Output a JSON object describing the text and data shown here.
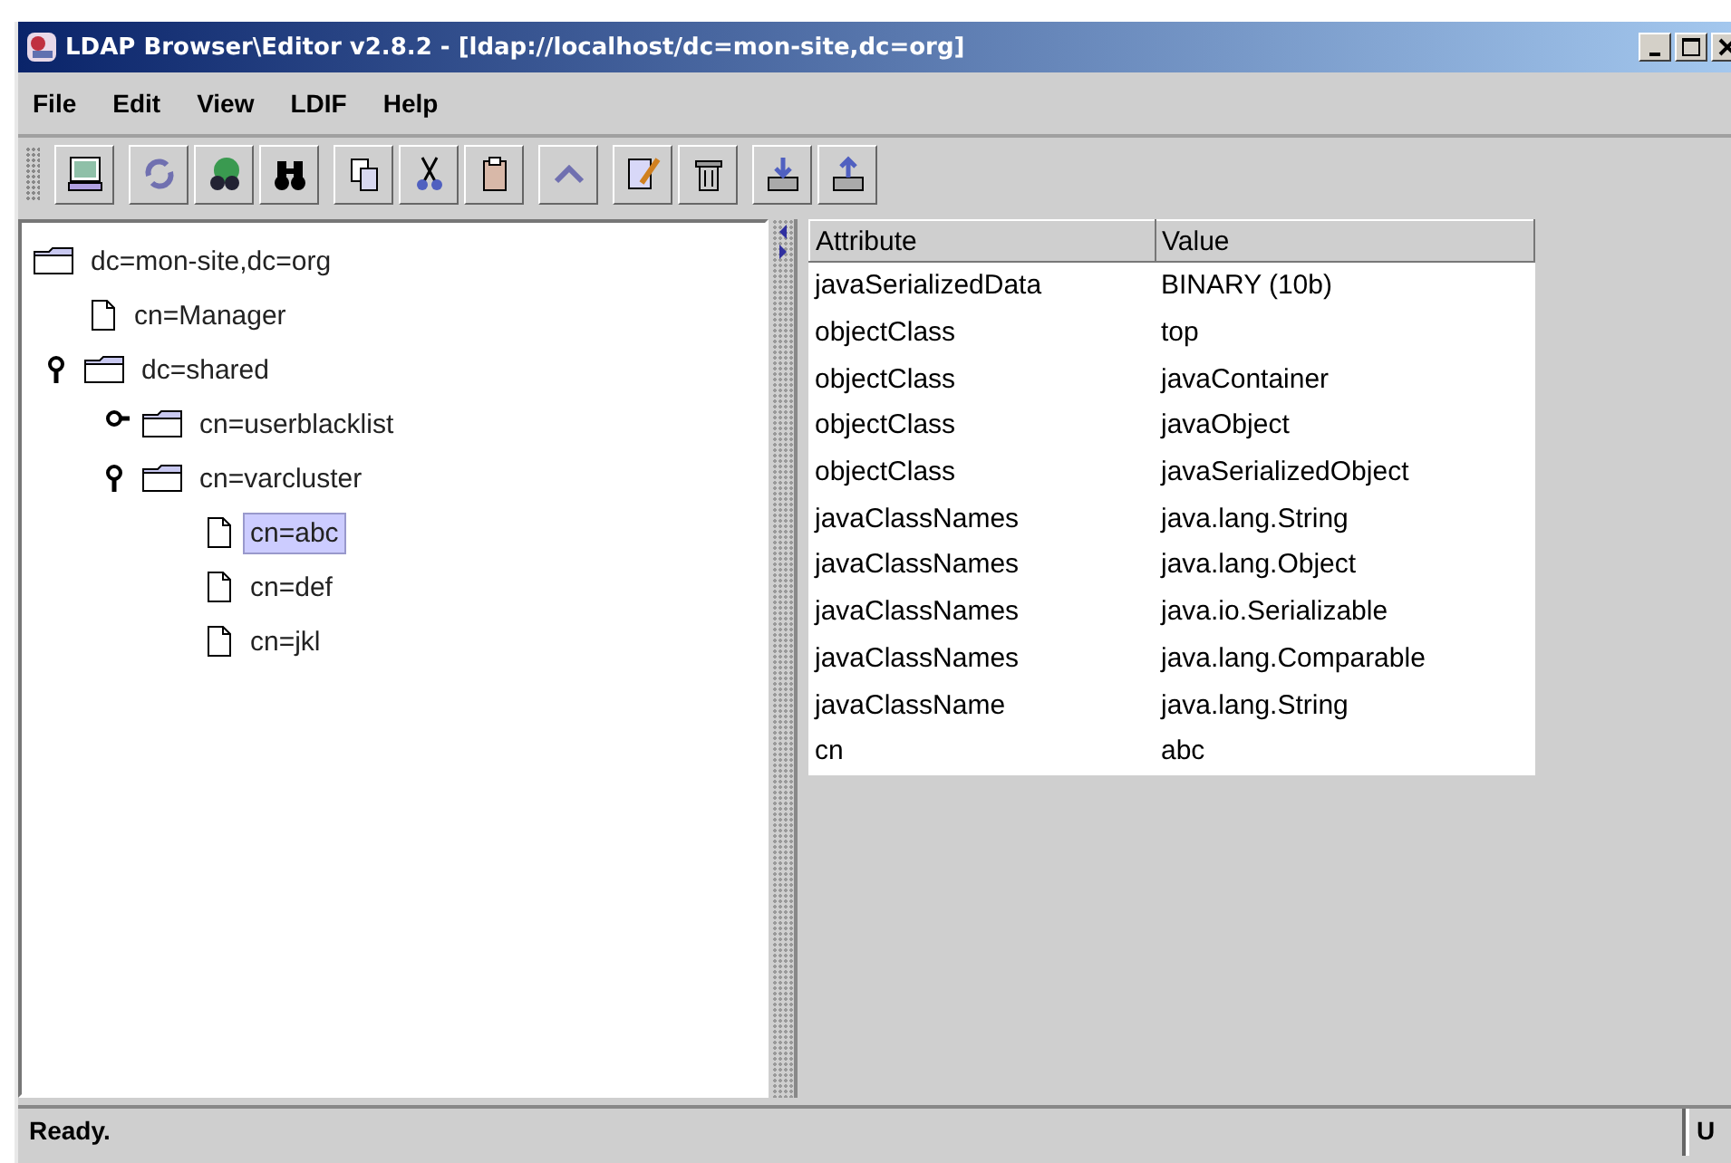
{
  "window": {
    "title": "LDAP Browser\\Editor v2.8.2 - [ldap://localhost/dc=mon-site,dc=org]"
  },
  "menu": [
    "File",
    "Edit",
    "View",
    "LDIF",
    "Help"
  ],
  "tree": [
    {
      "label": "dc=mon-site,dc=org",
      "kind": "folder",
      "selected": false,
      "children": [
        {
          "label": "cn=Manager",
          "kind": "leaf",
          "selected": false
        },
        {
          "label": "dc=shared",
          "kind": "folder",
          "expanded": true,
          "selected": false,
          "children": [
            {
              "label": "cn=userblacklist",
              "kind": "folder",
              "expanded": false,
              "selected": false
            },
            {
              "label": "cn=varcluster",
              "kind": "folder",
              "expanded": true,
              "selected": false,
              "children": [
                {
                  "label": "cn=abc",
                  "kind": "leaf",
                  "selected": true
                },
                {
                  "label": "cn=def",
                  "kind": "leaf",
                  "selected": false
                },
                {
                  "label": "cn=jkl",
                  "kind": "leaf",
                  "selected": false
                }
              ]
            }
          ]
        }
      ]
    }
  ],
  "table": {
    "columns": [
      "Attribute",
      "Value"
    ],
    "rows": [
      [
        "javaSerializedData",
        "BINARY (10b)"
      ],
      [
        "objectClass",
        "top"
      ],
      [
        "objectClass",
        "javaContainer"
      ],
      [
        "objectClass",
        "javaObject"
      ],
      [
        "objectClass",
        "javaSerializedObject"
      ],
      [
        "javaClassNames",
        "java.lang.String"
      ],
      [
        "javaClassNames",
        "java.lang.Object"
      ],
      [
        "javaClassNames",
        "java.io.Serializable"
      ],
      [
        "javaClassNames",
        "java.lang.Comparable"
      ],
      [
        "javaClassName",
        "java.lang.String"
      ],
      [
        "cn",
        "abc"
      ]
    ]
  },
  "status_bar": {
    "message": "Ready.",
    "cell_2": "U"
  }
}
